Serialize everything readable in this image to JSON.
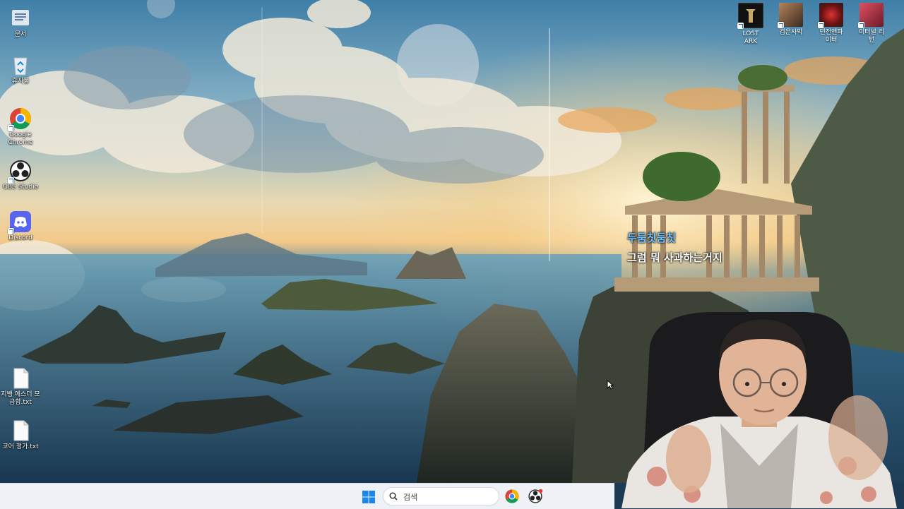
{
  "desktop": {
    "icons": [
      {
        "label": "문서",
        "icon": "documents-folder-icon"
      },
      {
        "label": "휴지통",
        "icon": "recycle-bin-icon"
      },
      {
        "label": "Google Chrome",
        "icon": "chrome-icon"
      },
      {
        "label": "OBS Studio",
        "icon": "obs-icon"
      },
      {
        "label": "Discord",
        "icon": "discord-icon"
      },
      {
        "label": "지뱅 에스더 모금함.txt",
        "icon": "text-file-icon"
      },
      {
        "label": "코어 정가.txt",
        "icon": "text-file-icon"
      }
    ],
    "top_right_icons": [
      {
        "label": "LOST ARK",
        "icon": "lost-ark-icon"
      },
      {
        "label": "검은사막",
        "icon": "black-desert-icon"
      },
      {
        "label": "던전앤파이터",
        "icon": "dungeon-fighter-icon"
      },
      {
        "label": "이터널 리턴",
        "icon": "eternal-return-icon"
      }
    ]
  },
  "chat": {
    "username": "두둠칫둠칫",
    "message": "그럼 뭐 사과하는거지"
  },
  "taskbar": {
    "search_placeholder": "검색",
    "apps": [
      {
        "name": "Google Chrome",
        "icon": "chrome-icon"
      },
      {
        "name": "OBS Studio",
        "icon": "obs-icon"
      }
    ]
  },
  "colors": {
    "chat_name": "#6ec3ff",
    "taskbar_bg": "#eef1f5",
    "windows_blue": "#1a86f0"
  }
}
